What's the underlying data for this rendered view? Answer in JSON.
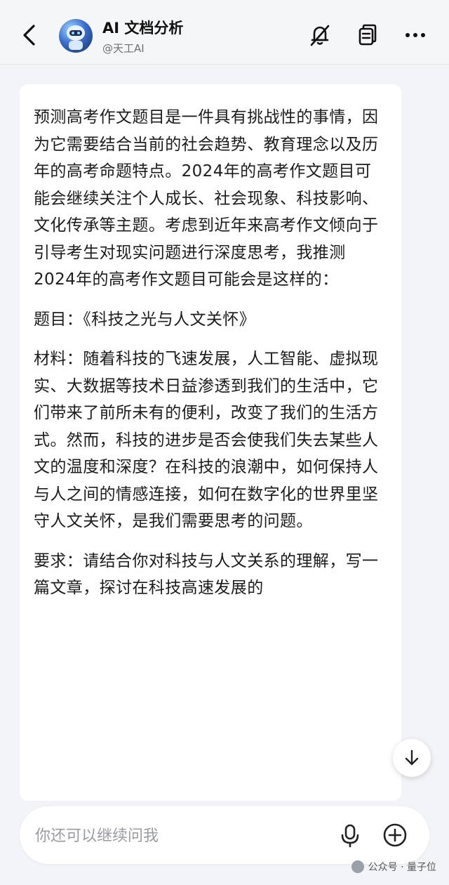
{
  "header": {
    "title": "AI 文档分析",
    "subtitle": "@天工AI",
    "icons": [
      "back-arrow-icon",
      "mute-icon",
      "copy-icon",
      "more-icon"
    ]
  },
  "message": {
    "paragraphs": [
      "预测高考作文题目是一件具有挑战性的事情，因为它需要结合当前的社会趋势、教育理念以及历年的高考命题特点。2024年的高考作文题目可能会继续关注个人成长、社会现象、科技影响、文化传承等主题。考虑到近年来高考作文倾向于引导考生对现实问题进行深度思考，我推测2024年的高考作文题目可能会是这样的：",
      "题目：《科技之光与人文关怀》",
      "材料：随着科技的飞速发展，人工智能、虚拟现实、大数据等技术日益渗透到我们的生活中，它们带来了前所未有的便利，改变了我们的生活方式。然而，科技的进步是否会使我们失去某些人文的温度和深度？在科技的浪潮中，如何保持人与人之间的情感连接，如何在数字化的世界里坚守人文关怀，是我们需要思考的问题。",
      "要求：请结合你对科技与人文关系的理解，写一篇文章，探讨在科技高速发展的"
    ]
  },
  "input": {
    "placeholder": "你还可以继续问我"
  },
  "watermark": {
    "text": "公众号 · 量子位"
  },
  "colors": {
    "background": "#f3f4f7",
    "card": "#ffffff",
    "text": "#1c1c1e",
    "muted": "#9a9ca3"
  }
}
